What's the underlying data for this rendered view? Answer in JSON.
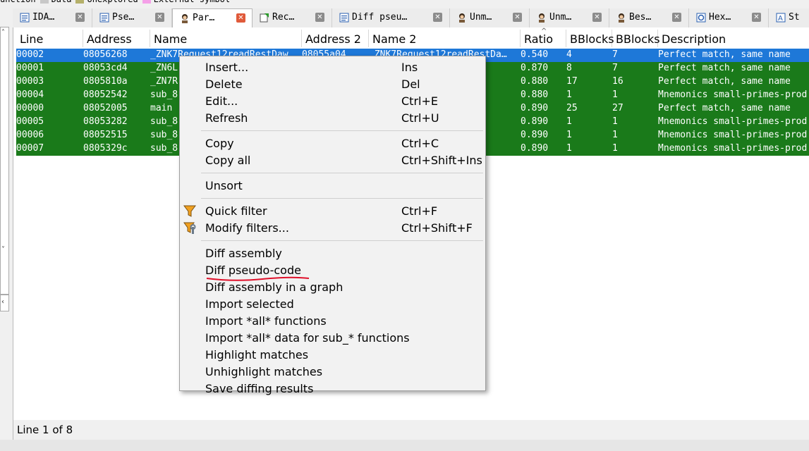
{
  "legend": {
    "items": [
      {
        "label": "unction",
        "color": ""
      },
      {
        "label": "Data",
        "color": "#c8c8c8"
      },
      {
        "label": "Unexplored",
        "color": "#b5b06a"
      },
      {
        "label": "External symbol",
        "color": "#f5a0e8"
      }
    ]
  },
  "tabs": [
    {
      "label": "IDA…",
      "icon": "ida-view-icon",
      "active": false
    },
    {
      "label": "Pse…",
      "icon": "pseudocode-icon",
      "active": false
    },
    {
      "label": "Par…",
      "icon": "bindiff-avatar-icon",
      "active": true
    },
    {
      "label": "Rec…",
      "icon": "recent-scripts-icon",
      "active": false
    },
    {
      "label": "Diff pseu…",
      "icon": "pseudocode-icon",
      "active": false
    },
    {
      "label": "Unm…",
      "icon": "bindiff-avatar-icon",
      "active": false
    },
    {
      "label": "Unm…",
      "icon": "bindiff-avatar-icon",
      "active": false
    },
    {
      "label": "Bes…",
      "icon": "bindiff-avatar-icon",
      "active": false
    },
    {
      "label": "Hex…",
      "icon": "hex-view-icon",
      "active": false
    },
    {
      "label": "St",
      "icon": "strings-icon",
      "active": false
    }
  ],
  "table": {
    "columns": [
      "Line",
      "Address",
      "Name",
      "Address 2",
      "Name 2",
      "Ratio",
      "BBlocks",
      "BBlocks",
      "Description"
    ],
    "rows": [
      {
        "line": "00002",
        "address": "08056268",
        "name": "_ZNK7Request12readRestDaw",
        "address2": "08055a04",
        "name2": "_ZNK7Request12readRestDa…",
        "ratio": "0.540",
        "bb1": "4",
        "bb2": "7",
        "desc": "Perfect match, same name",
        "selected": true
      },
      {
        "line": "00001",
        "address": "08053cd4",
        "name": "_ZN6L",
        "address2": "",
        "name2": "",
        "ratio": "0.870",
        "bb1": "8",
        "bb2": "7",
        "desc": "Perfect match, same name",
        "selected": false
      },
      {
        "line": "00003",
        "address": "0805810a",
        "name": "_ZN7R",
        "address2": "",
        "name2": "y",
        "ratio": "0.880",
        "bb1": "17",
        "bb2": "16",
        "desc": "Perfect match, same name",
        "selected": false
      },
      {
        "line": "00004",
        "address": "08052542",
        "name": "sub_8",
        "address2": "",
        "name2": "",
        "ratio": "0.880",
        "bb1": "1",
        "bb2": "1",
        "desc": "Mnemonics small-primes-prod",
        "selected": false
      },
      {
        "line": "00000",
        "address": "08052005",
        "name": "main",
        "address2": "",
        "name2": "",
        "ratio": "0.890",
        "bb1": "25",
        "bb2": "27",
        "desc": "Perfect match, same name",
        "selected": false
      },
      {
        "line": "00005",
        "address": "08053282",
        "name": "sub_8",
        "address2": "",
        "name2": "",
        "ratio": "0.890",
        "bb1": "1",
        "bb2": "1",
        "desc": "Mnemonics small-primes-prod",
        "selected": false
      },
      {
        "line": "00006",
        "address": "08052515",
        "name": "sub_8",
        "address2": "",
        "name2": "",
        "ratio": "0.890",
        "bb1": "1",
        "bb2": "1",
        "desc": "Mnemonics small-primes-prod",
        "selected": false
      },
      {
        "line": "00007",
        "address": "0805329c",
        "name": "sub_8",
        "address2": "",
        "name2": "",
        "ratio": "0.890",
        "bb1": "1",
        "bb2": "1",
        "desc": "Mnemonics small-primes-prod",
        "selected": false
      }
    ]
  },
  "status": {
    "text": "Line 1 of 8"
  },
  "menu": {
    "groups": [
      [
        {
          "label": "Insert...",
          "shortcut": "Ins"
        },
        {
          "label": "Delete",
          "shortcut": "Del"
        },
        {
          "label": "Edit...",
          "shortcut": "Ctrl+E"
        },
        {
          "label": "Refresh",
          "shortcut": "Ctrl+U"
        }
      ],
      [
        {
          "label": "Copy",
          "shortcut": "Ctrl+C"
        },
        {
          "label": "Copy all",
          "shortcut": "Ctrl+Shift+Ins"
        }
      ],
      [
        {
          "label": "Unsort",
          "shortcut": ""
        }
      ],
      [
        {
          "label": "Quick filter",
          "shortcut": "Ctrl+F",
          "icon": "funnel-icon"
        },
        {
          "label": "Modify filters...",
          "shortcut": "Ctrl+Shift+F",
          "icon": "funnel-wrench-icon"
        }
      ],
      [
        {
          "label": "Diff assembly",
          "shortcut": ""
        },
        {
          "label": "Diff pseudo-code",
          "shortcut": "",
          "underlined": true
        },
        {
          "label": "Diff assembly in a graph",
          "shortcut": ""
        },
        {
          "label": "Import selected",
          "shortcut": ""
        },
        {
          "label": "Import *all* functions",
          "shortcut": ""
        },
        {
          "label": "Import *all* data for sub_* functions",
          "shortcut": ""
        },
        {
          "label": "Highlight matches",
          "shortcut": ""
        },
        {
          "label": "Unhighlight matches",
          "shortcut": ""
        },
        {
          "label": "Save diffing results",
          "shortcut": ""
        }
      ]
    ]
  },
  "colors": {
    "match_row": "#1a7a1a",
    "selected_row": "#1e78d8",
    "active_tab_close": "#e05a3a",
    "annotation_underline": "#e0102a"
  }
}
